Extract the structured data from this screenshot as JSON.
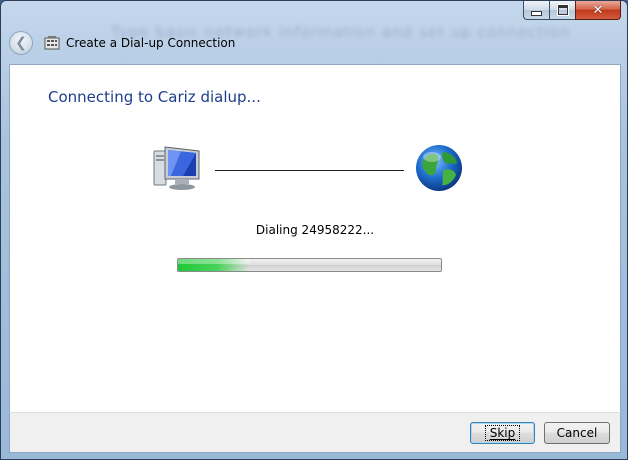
{
  "window": {
    "title": "Create a Dial-up Connection",
    "background_glimpse": "Type basic network information and set up connection",
    "caption_buttons": {
      "minimize_icon": "minimize-icon",
      "maximize_icon": "maximize-icon",
      "close_glyph": "✕"
    },
    "back_glyph": "❮"
  },
  "content": {
    "heading": "Connecting to Cariz dialup...",
    "status": "Dialing 24958222...",
    "progress_fraction": 0.27,
    "icons": [
      "computer-icon",
      "globe-icon"
    ]
  },
  "footer": {
    "skip_label": "Skip",
    "cancel_label": "Cancel"
  },
  "colors": {
    "heading": "#1e3e8a",
    "progress_fill": "#21c83a",
    "close_button": "#c1391d"
  }
}
